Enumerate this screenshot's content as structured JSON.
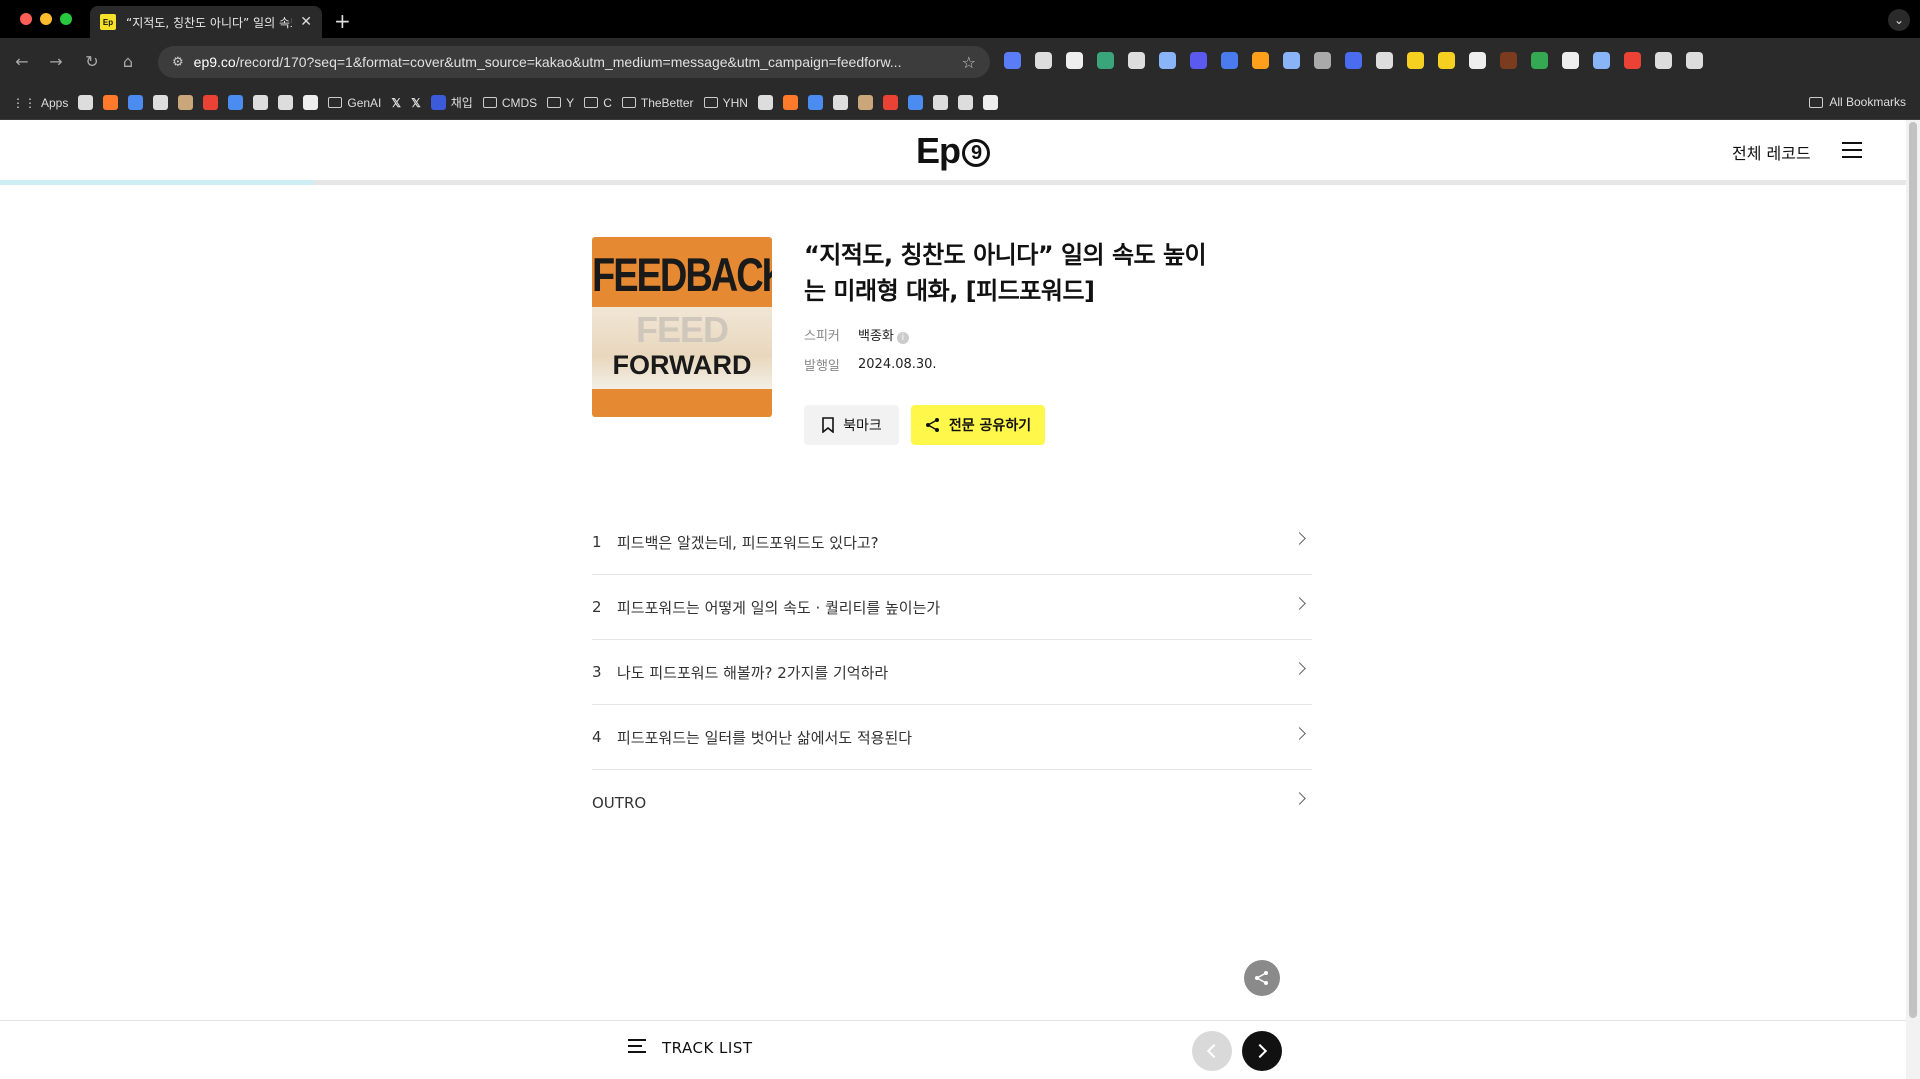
{
  "browser": {
    "tab_title": "“지적도, 칭찬도 아니다” 일의 속도",
    "tab_favicon": "Ep",
    "url_domain": "ep9.co",
    "url_path": "/record/170?seq=1&format=cover&utm_source=kakao&utm_medium=message&utm_campaign=feedforw...",
    "bookmarks": [
      "Apps",
      "GenAI",
      "채입",
      "CMDS",
      "Y",
      "C",
      "TheBetter",
      "YHN"
    ],
    "all_bookmarks": "All Bookmarks",
    "extension_colors": [
      "#5b7cf7",
      "#dddddd",
      "#eeeeee",
      "#3aa57a",
      "#dddddd",
      "#8ab4f8",
      "#5a5af0",
      "#4a7cf0",
      "#ff9f1a",
      "#8ab4f8",
      "#aaaaaa",
      "#4a6cf0",
      "#dddddd",
      "#f5d020",
      "#f5d020",
      "#eeeeee",
      "#7a3b1e",
      "#34a853",
      "#eeeeee",
      "#8ab4f8",
      "#ea4335",
      "#dddddd",
      "#dddddd"
    ],
    "bookmark_icon_colors": [
      "#dddddd",
      "#ff7a2a",
      "#4a8cf0",
      "#dddddd",
      "#c9a77a",
      "#ea4335",
      "#4a8cf0",
      "#dddddd",
      "#dddddd",
      "#eeeeee"
    ]
  },
  "header": {
    "logo": "Ep",
    "logo_nine": "9",
    "all_records": "전체 레코드"
  },
  "progress": 0.165,
  "episode": {
    "cover_top": "FEEDBACK",
    "cover_ghost": "FEED",
    "cover_bottom": "FORWARD",
    "title": "“지적도, 칭찬도 아니다” 일의 속도 높이는 미래형 대화, [피드포워드]",
    "speaker_label": "스피커",
    "speaker": "백종화",
    "date_label": "발행일",
    "date": "2024.08.30.",
    "bookmark_label": "북마크",
    "share_label": "전문 공유하기"
  },
  "tracks": [
    {
      "num": "1",
      "title": "피드백은 알겠는데, 피드포워드도 있다고?"
    },
    {
      "num": "2",
      "title": "피드포워드는 어떻게 일의 속도 · 퀄리티를 높이는가"
    },
    {
      "num": "3",
      "title": "나도 피드포워드 해볼까? 2가지를 기억하라"
    },
    {
      "num": "4",
      "title": "피드포워드는 일터를 벗어난 삶에서도 적용된다"
    },
    {
      "num": "",
      "title": "OUTRO"
    }
  ],
  "bottom": {
    "track_list": "TRACK LIST"
  }
}
